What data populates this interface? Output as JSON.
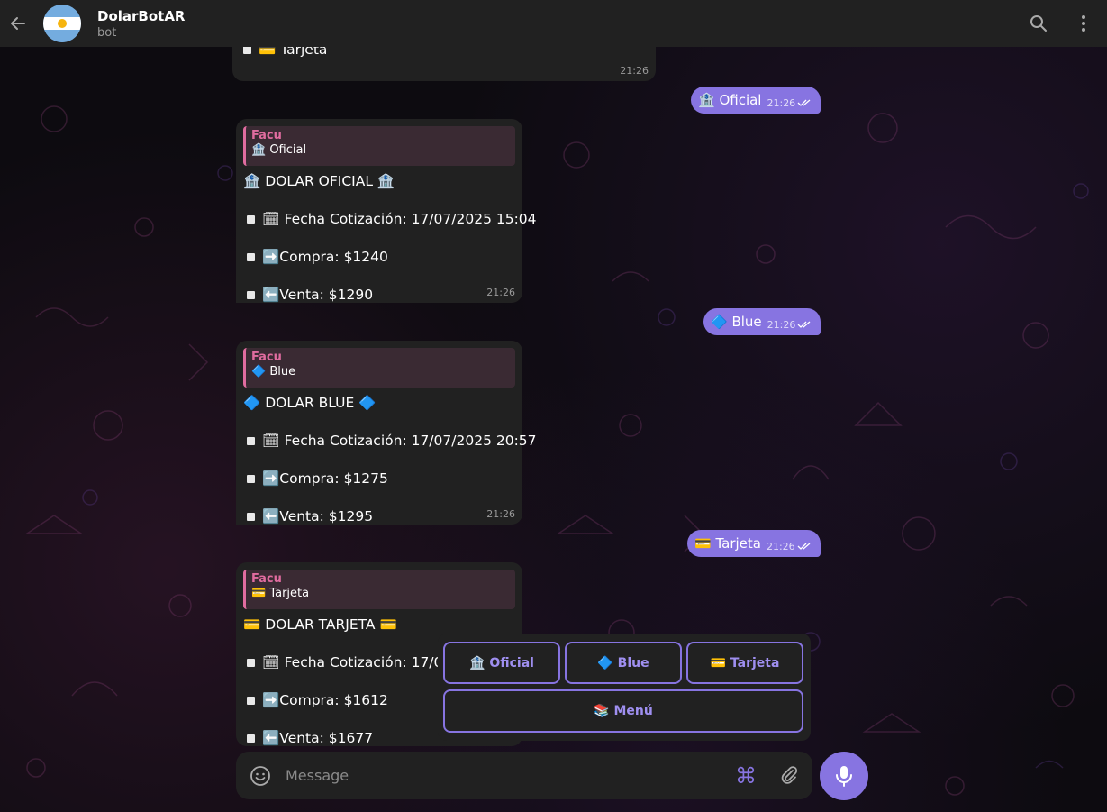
{
  "header": {
    "title": "DolarBotAR",
    "subtitle": "bot"
  },
  "top_partial": {
    "text": "💳 Tarjeta",
    "time": "21:26"
  },
  "outgoing": [
    {
      "text": "🏦 Oficial",
      "time": "21:26"
    },
    {
      "text": "🔷 Blue",
      "time": "21:26"
    },
    {
      "text": "💳 Tarjeta",
      "time": "21:26"
    }
  ],
  "incoming": [
    {
      "reply_name": "Facu",
      "reply_text": "🏦 Oficial",
      "heading": "🏦  DOLAR OFICIAL 🏦",
      "fecha": "🗓 Fecha Cotización: 17/07/2025 15:04",
      "compra": "➡️Compra: $1240",
      "venta": "⬅️Venta: $1290",
      "time": "21:26"
    },
    {
      "reply_name": "Facu",
      "reply_text": "🔷 Blue",
      "heading": "🔷  DOLAR BLUE 🔷",
      "fecha": "🗓 Fecha Cotización: 17/07/2025 20:57",
      "compra": "➡️Compra: $1275",
      "venta": "⬅️Venta: $1295",
      "time": "21:26"
    },
    {
      "reply_name": "Facu",
      "reply_text": "💳 Tarjeta",
      "heading": "💳  DOLAR TARJETA 💳",
      "fecha": "🗓 Fecha Cotización: 17/07",
      "compra": "➡️Compra: $1612",
      "venta": "⬅️Venta: $1677",
      "time": ""
    }
  ],
  "keyboard": {
    "oficial": "🏦 Oficial",
    "blue": "🔷 Blue",
    "tarjeta": "💳 Tarjeta",
    "menu": "📚 Menú"
  },
  "composer": {
    "placeholder": "Message",
    "cmd_symbol": "⌘"
  },
  "colors": {
    "accent": "#8774e1",
    "bubble_in": "#212121",
    "reply_name": "#e06c9f"
  }
}
